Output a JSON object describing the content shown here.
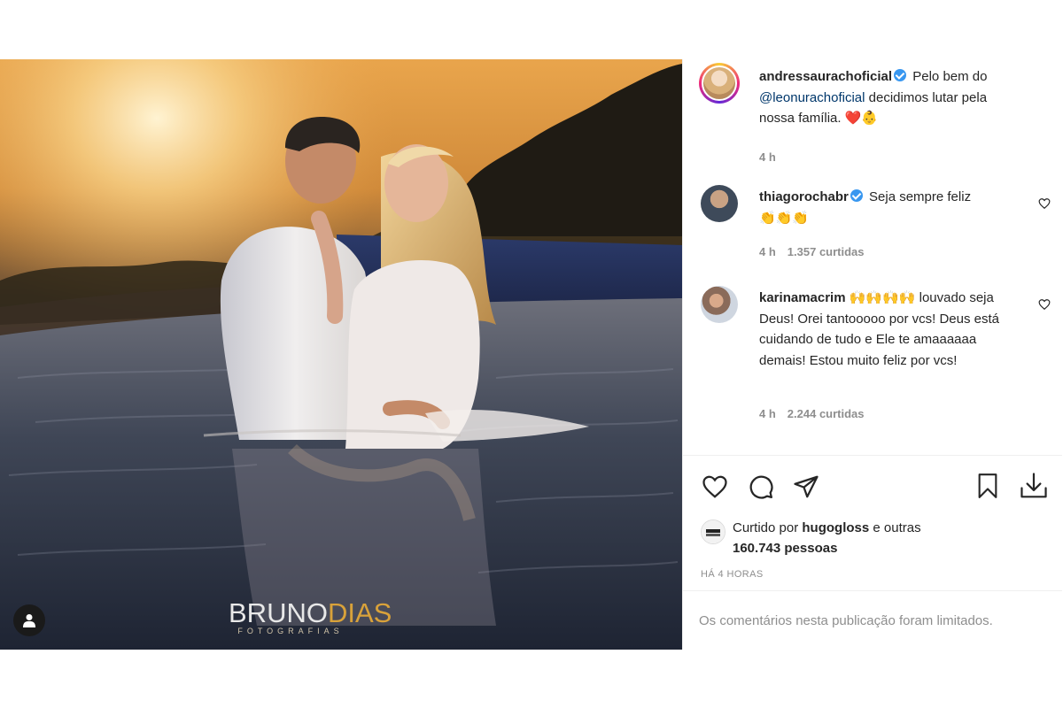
{
  "photo": {
    "watermark_main_a": "BRUNO",
    "watermark_main_b": "DIAS",
    "watermark_sub": "FOTOGRAFIAS",
    "tag_icon": "user-tag-icon"
  },
  "caption": {
    "username": "andressaurachoficial",
    "text_before": "Pelo bem do",
    "mention": "@leonurachoficial",
    "text_after": "decidimos lutar pela nossa família.",
    "emojis": "❤️👶",
    "time": "4 h"
  },
  "comments": [
    {
      "username": "thiagorochabr",
      "verified": true,
      "text": "Seja sempre feliz",
      "emojis": "👏👏👏",
      "time": "4 h",
      "likes": "1.357 curtidas"
    },
    {
      "username": "karinamacrim",
      "verified": false,
      "emojis": "🙌🙌🙌🙌",
      "text": "louvado seja Deus! Orei tantooooo por vcs! Deus está cuidando de tudo e Ele te amaaaaaa demais! Estou muito feliz por vcs!",
      "time": "4 h",
      "likes": "2.244 curtidas"
    }
  ],
  "actions": {
    "like": "heart-icon",
    "comment": "comment-icon",
    "share": "share-icon",
    "save": "bookmark-icon",
    "download": "download-icon"
  },
  "likes": {
    "prefix": "Curtido por",
    "user": "hugogloss",
    "conj": "e",
    "others_prefix": "outras",
    "count": "160.743 pessoas"
  },
  "post_time": "HÁ 4 HORAS",
  "comments_limited": "Os comentários nesta publicação foram limitados.",
  "colors": {
    "link": "#00376b",
    "verified": "#3897f0",
    "muted": "#8e8e8e",
    "text": "#262626"
  }
}
